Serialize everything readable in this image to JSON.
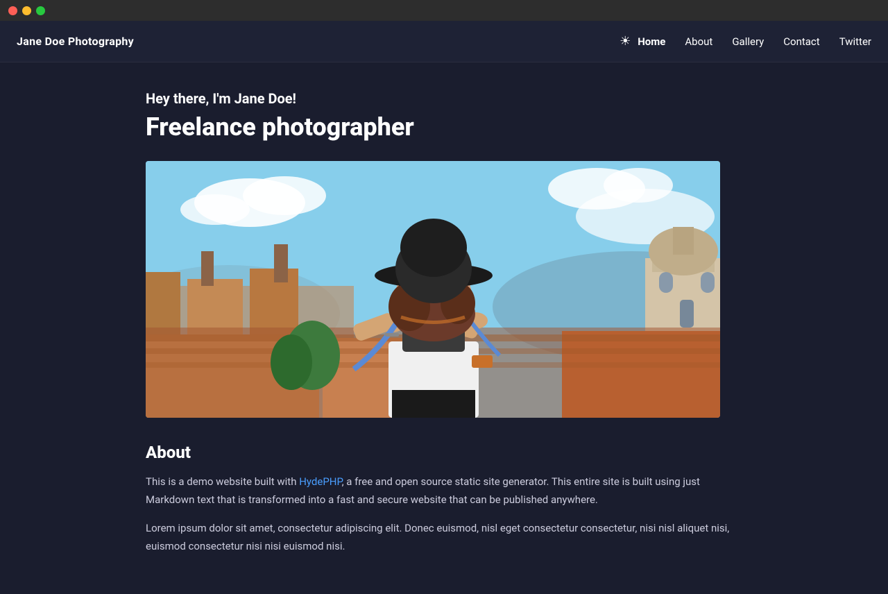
{
  "titlebar": {
    "buttons": [
      "close",
      "minimize",
      "maximize"
    ]
  },
  "nav": {
    "brand": "Jane Doe Photography",
    "icon": "☀",
    "links": [
      {
        "label": "Home",
        "active": true
      },
      {
        "label": "About",
        "active": false
      },
      {
        "label": "Gallery",
        "active": false
      },
      {
        "label": "Contact",
        "active": false
      },
      {
        "label": "Twitter",
        "active": false
      }
    ]
  },
  "hero": {
    "greeting": "Hey there, I'm Jane Doe!",
    "title": "Freelance photographer",
    "image_alt": "Photographer with camera and hat in front of European cityscape"
  },
  "about": {
    "title": "About",
    "intro_text": "This is a demo website built with ",
    "link_text": "HydePHP",
    "link_href": "#",
    "intro_text2": ", a free and open source static site generator. This entire site is built using just Markdown text that is transformed into a fast and secure website that can be published anywhere.",
    "lorem": "Lorem ipsum dolor sit amet, consectetur adipiscing elit. Donec euismod, nisl eget consectetur consectetur, nisi nisl aliquet nisi, euismod consectetur nisi nisi euismod nisi."
  }
}
